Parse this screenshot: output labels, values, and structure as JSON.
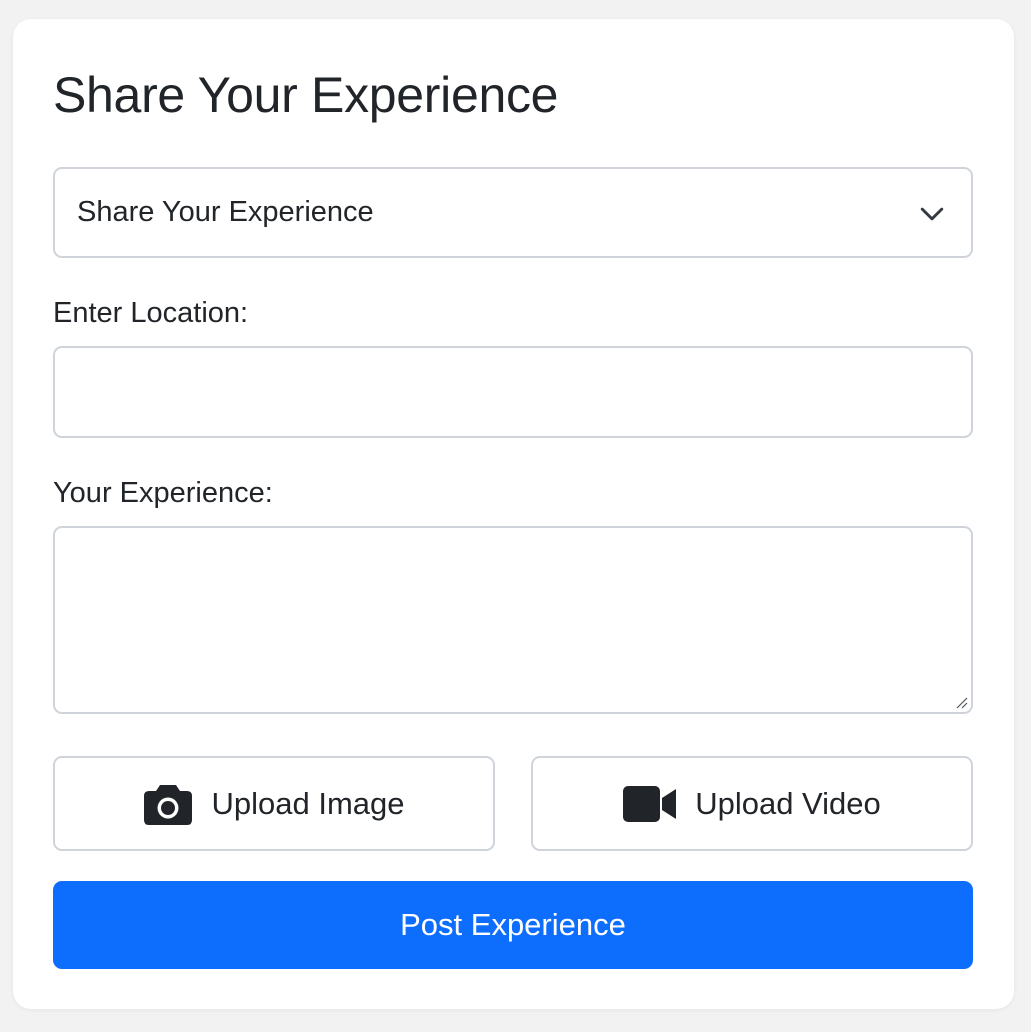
{
  "form": {
    "title": "Share Your Experience",
    "select": {
      "selected_value": "Share Your Experience"
    },
    "location": {
      "label": "Enter Location:",
      "value": "",
      "placeholder": ""
    },
    "experience": {
      "label": "Your Experience:",
      "value": "",
      "placeholder": ""
    },
    "upload_image": {
      "label": "Upload Image",
      "icon": "camera-icon"
    },
    "upload_video": {
      "label": "Upload Video",
      "icon": "video-camera-icon"
    },
    "submit": {
      "label": "Post Experience"
    }
  },
  "colors": {
    "primary": "#0d6efd",
    "border": "#ced4da",
    "text": "#212529",
    "background": "#f2f2f2",
    "card": "#ffffff"
  }
}
